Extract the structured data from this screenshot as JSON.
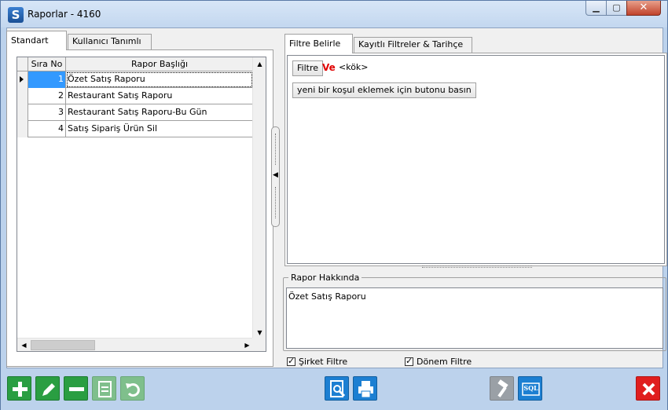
{
  "window": {
    "title": "Raporlar - 4160",
    "app_icon_letter": "S",
    "controls": [
      "minimize",
      "maximize",
      "close"
    ]
  },
  "left_panel": {
    "tabs": [
      {
        "label": "Standart",
        "active": true
      },
      {
        "label": "Kullanıcı Tanımlı",
        "active": false
      }
    ],
    "grid": {
      "columns": [
        "Sıra No",
        "Rapor Başlığı"
      ],
      "rows": [
        {
          "no": "1",
          "title": "Özet Satış Raporu",
          "selected": true
        },
        {
          "no": "2",
          "title": "Restaurant Satış Raporu",
          "selected": false
        },
        {
          "no": "3",
          "title": "Restaurant Satış Raporu-Bu Gün",
          "selected": false
        },
        {
          "no": "4",
          "title": "Satış Sipariş Ürün Sil",
          "selected": false
        }
      ]
    }
  },
  "right_panel": {
    "tabs": [
      {
        "label": "Filtre Belirle",
        "active": true
      },
      {
        "label": "Kayıtlı Filtreler & Tarihçe",
        "active": false
      }
    ],
    "filter": {
      "filter_button": "Filtre",
      "operator": "Ve",
      "root": "<kök>",
      "add_condition_button": "yeni bir koşul eklemek için butonu basın"
    },
    "about": {
      "title": "Rapor Hakkında",
      "text": "Özet Satış Raporu"
    },
    "checkboxes": [
      {
        "label": "Şirket Filtre",
        "checked": true
      },
      {
        "label": "Dönem Filtre",
        "checked": true
      }
    ]
  },
  "toolbar": {
    "buttons": [
      "add",
      "edit",
      "remove",
      "save",
      "undo",
      "preview",
      "print",
      "tools",
      "sql",
      "close"
    ],
    "sql_label": "SQL"
  }
}
